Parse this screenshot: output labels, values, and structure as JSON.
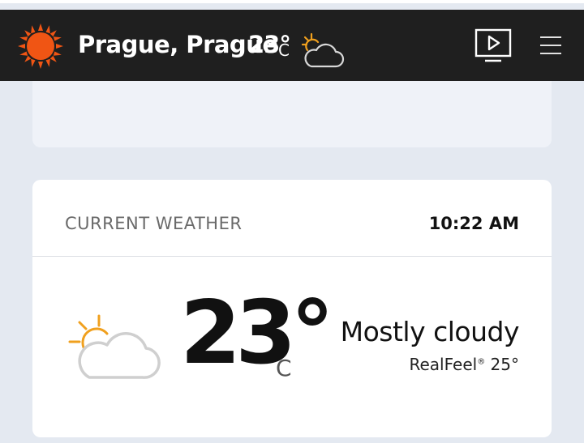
{
  "header": {
    "location": "Prague, Prague",
    "temp": "23°",
    "unit": "C",
    "weather_icon": "partly-cloudy-icon",
    "logo_icon": "sun-logo-icon",
    "video_icon": "video-play-icon",
    "menu_icon": "hamburger-menu-icon"
  },
  "current": {
    "title": "CURRENT WEATHER",
    "time": "10:22 AM",
    "temp": "23°",
    "unit": "C",
    "phrase": "Mostly cloudy",
    "realfeel_label": "RealFeel",
    "realfeel_mark": "®",
    "realfeel_value": "25°",
    "icon": "mostly-cloudy-icon"
  },
  "colors": {
    "header_bg": "#1f1f1f",
    "brand_orange": "#f05514",
    "sun_orange": "#f0a01e",
    "page_bg": "#e4e9f1"
  }
}
